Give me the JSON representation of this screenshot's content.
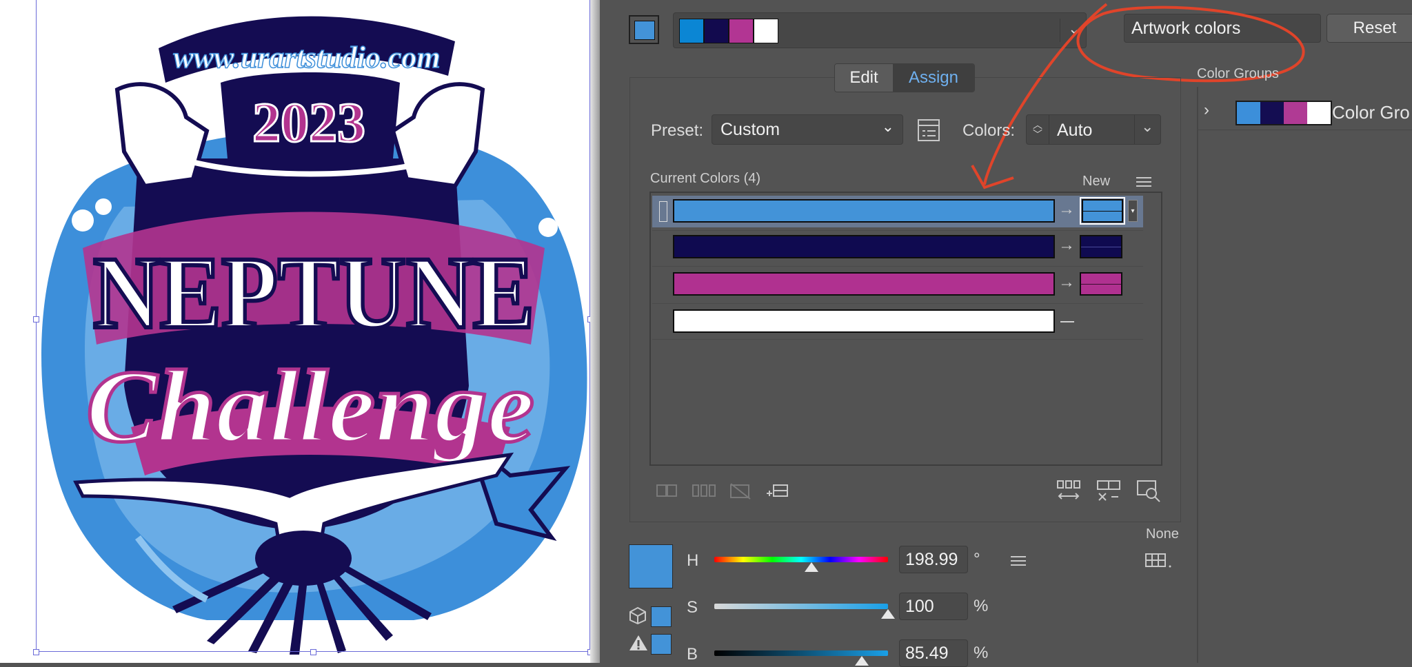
{
  "artwork": {
    "url_text": "www.urartstudio.com",
    "year": "2023",
    "title": "NEPTUNE",
    "subtitle": "Challenge"
  },
  "top_bar": {
    "group_name": "Artwork colors",
    "reset_label": "Reset",
    "group_swatches": [
      "#0b86d4",
      "#120a4e",
      "#b23593",
      "#ffffff"
    ]
  },
  "tabs": [
    {
      "label": "Edit",
      "active": false
    },
    {
      "label": "Assign",
      "active": true
    }
  ],
  "preset": {
    "label": "Preset:",
    "value": "Custom"
  },
  "colors": {
    "label": "Colors:",
    "value": "Auto"
  },
  "current_colors": {
    "header": "Current Colors (4)",
    "new_label": "New",
    "rows": [
      {
        "current": "#4393d8",
        "new": "#4393d8",
        "selected": true
      },
      {
        "current": "#0f0a50",
        "new": "#0f0a50",
        "selected": false
      },
      {
        "current": "#b03190",
        "new": "#b03190",
        "selected": false
      },
      {
        "current": "#ffffff",
        "new": null,
        "selected": false
      }
    ]
  },
  "color_groups": {
    "title": "Color Groups",
    "item_label": "Color Gro",
    "swatches": [
      "#3c8fda",
      "#140d52",
      "#b03a94",
      "#ffffff"
    ]
  },
  "hsb": {
    "none_label": "None",
    "preview_color": "#4393d8",
    "h": {
      "label": "H",
      "value": "198.99",
      "unit": "°",
      "fraction": 0.56
    },
    "s": {
      "label": "S",
      "value": "100",
      "unit": "%",
      "fraction": 1.0
    },
    "b": {
      "label": "B",
      "value": "85.49",
      "unit": "%",
      "fraction": 0.85
    }
  },
  "annotation_color": "#e0442a"
}
